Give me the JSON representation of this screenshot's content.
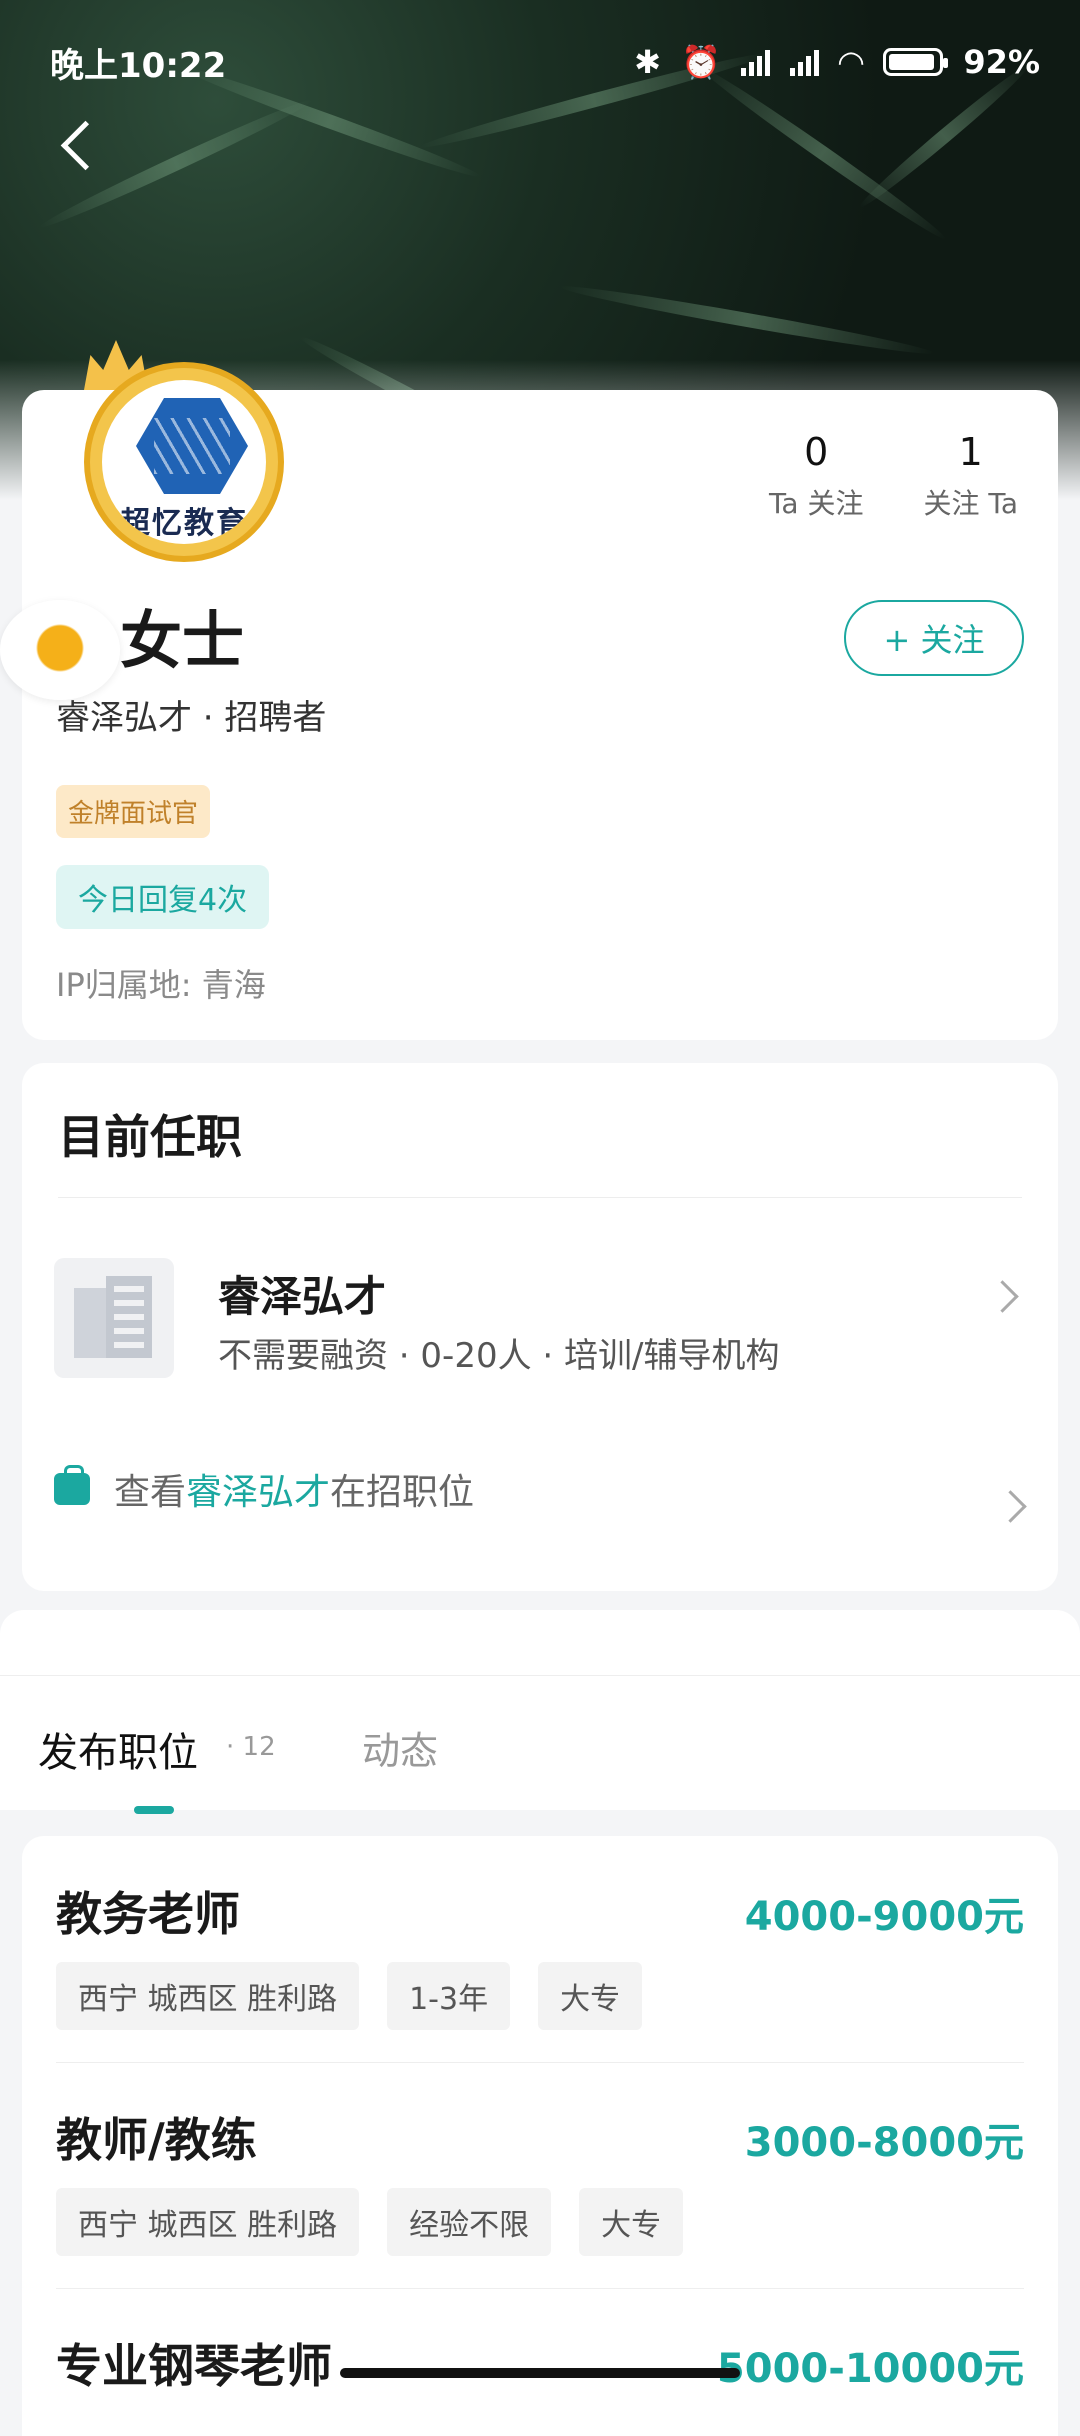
{
  "status_bar": {
    "time": "晚上10:22",
    "battery": "92%",
    "battery_level": 0.92
  },
  "profile": {
    "logo_text": "超忆教育",
    "name": "女士",
    "following_count": "0",
    "following_label": "Ta 关注",
    "followers_count": "1",
    "followers_label": "关注 Ta",
    "follow_button": "+ 关注",
    "subline": "睿泽弘才 · 招聘者",
    "gold_tag": "金牌面试官",
    "reply_tag": "今日回复4次",
    "ip": "IP归属地: 青海"
  },
  "current_job": {
    "title": "目前任职",
    "company": "睿泽弘才",
    "info": "不需要融资 · 0-20人 · 培训/辅导机构",
    "link_prefix": "查看",
    "link_company": "睿泽弘才",
    "link_suffix": "在招职位"
  },
  "tabs": {
    "active": "发布职位",
    "active_count": "· 12",
    "other": "动态"
  },
  "jobs": [
    {
      "title": "教务老师",
      "salary": "4000-9000元",
      "tags": [
        "西宁 城西区 胜利路",
        "1-3年",
        "大专"
      ]
    },
    {
      "title": "教师/教练",
      "salary": "3000-8000元",
      "tags": [
        "西宁 城西区 胜利路",
        "经验不限",
        "大专"
      ]
    },
    {
      "title": "专业钢琴老师",
      "salary": "5000-10000元",
      "tags": []
    }
  ],
  "colors": {
    "accent": "#1ba8a0",
    "gold": "#c0812a"
  }
}
